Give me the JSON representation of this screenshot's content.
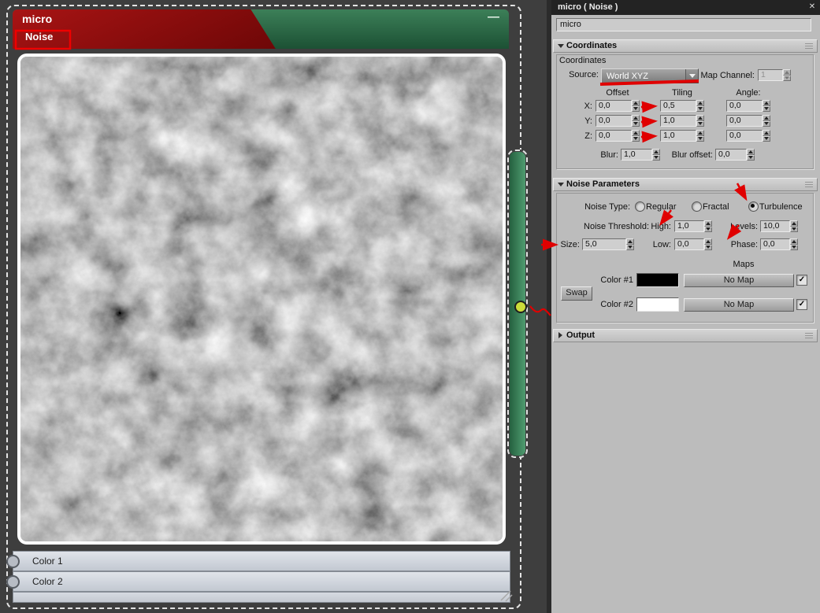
{
  "icons": {
    "close": "✕",
    "minimize": "—",
    "check": "✓"
  },
  "node": {
    "title": "micro",
    "subtitle": "Noise",
    "slots": [
      {
        "label": "Color 1"
      },
      {
        "label": "Color 2"
      }
    ]
  },
  "panel": {
    "titlebar": {
      "title": "micro  ( Noise )"
    },
    "name_field": "micro",
    "coordinates": {
      "header": "Coordinates",
      "group_label": "Coordinates",
      "source_label": "Source:",
      "source_value": "World XYZ",
      "map_channel_label": "Map Channel:",
      "map_channel_value": "1",
      "columns": {
        "offset": "Offset",
        "tiling": "Tiling",
        "angle": "Angle:"
      },
      "rows": [
        {
          "axis": "X:",
          "offset": "0,0",
          "tiling": "0,5",
          "angle": "0,0"
        },
        {
          "axis": "Y:",
          "offset": "0,0",
          "tiling": "1,0",
          "angle": "0,0"
        },
        {
          "axis": "Z:",
          "offset": "0,0",
          "tiling": "1,0",
          "angle": "0,0"
        }
      ],
      "blur_label": "Blur:",
      "blur_value": "1,0",
      "blur_offset_label": "Blur offset:",
      "blur_offset_value": "0,0"
    },
    "noise_parameters": {
      "header": "Noise Parameters",
      "noise_type_label": "Noise Type:",
      "radio_options": [
        {
          "label": "Regular",
          "selected": false
        },
        {
          "label": "Fractal",
          "selected": false
        },
        {
          "label": "Turbulence",
          "selected": true
        }
      ],
      "noise_threshold_label": "Noise Threshold:",
      "high_label": "High:",
      "high_value": "1,0",
      "levels_label": "Levels:",
      "levels_value": "10,0",
      "size_label": "Size:",
      "size_value": "5,0",
      "low_label": "Low:",
      "low_value": "0,0",
      "phase_label": "Phase:",
      "phase_value": "0,0",
      "maps_label": "Maps",
      "swap_label": "Swap",
      "no_map_label": "No Map",
      "color1_label": "Color #1",
      "color1_hex": "#000000",
      "color2_label": "Color #2",
      "color2_hex": "#ffffff"
    },
    "output": {
      "header": "Output"
    }
  }
}
